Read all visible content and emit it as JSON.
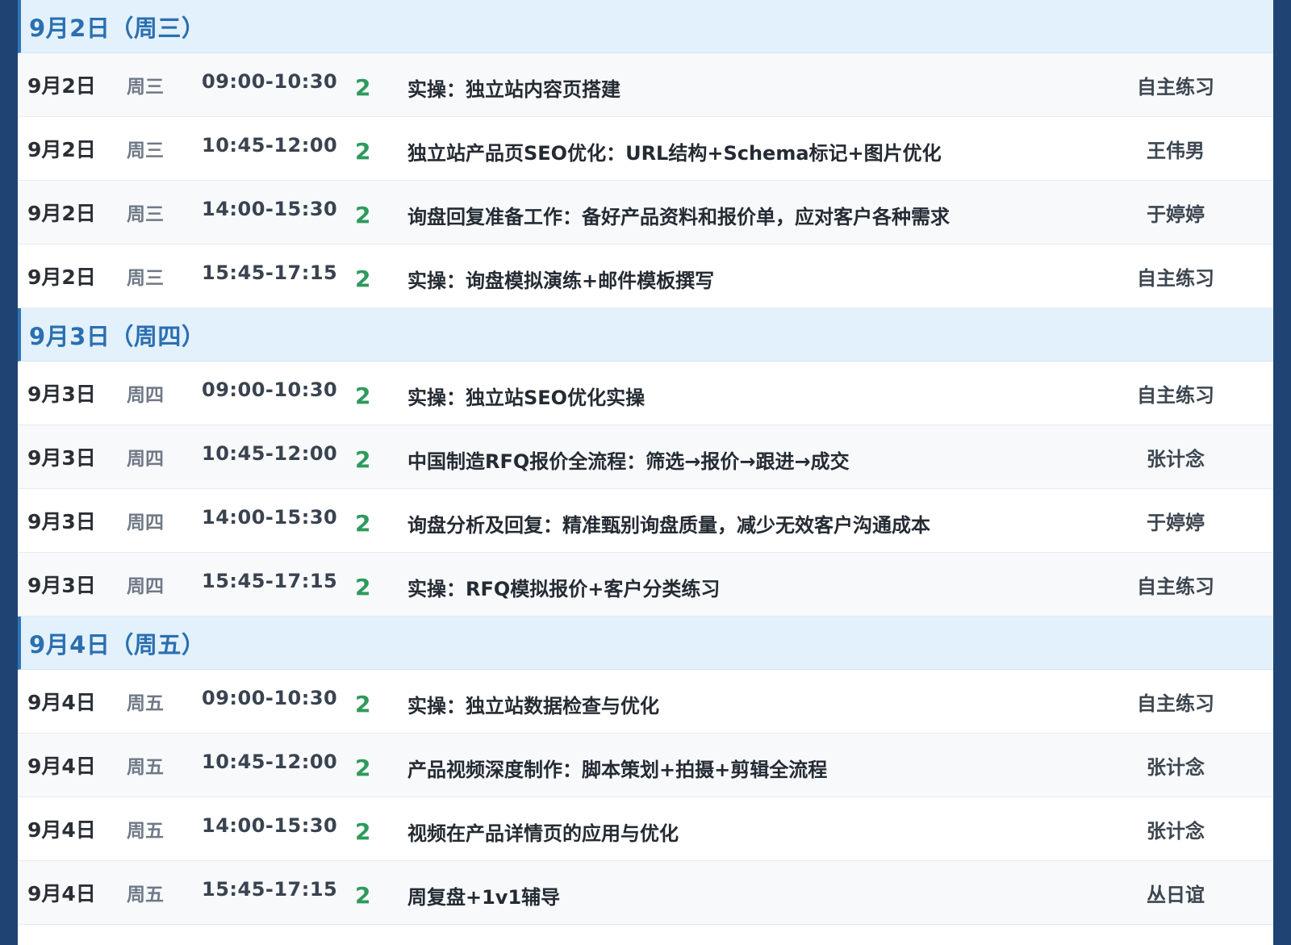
{
  "days": [
    {
      "header": "9月2日（周三）",
      "sessions": [
        {
          "date": "9月2日",
          "weekday": "周三",
          "time": "09:00-10:30",
          "hours": "2",
          "topic": "实操：独立站内容页搭建",
          "teacher": "自主练习"
        },
        {
          "date": "9月2日",
          "weekday": "周三",
          "time": "10:45-12:00",
          "hours": "2",
          "topic": "独立站产品页SEO优化：URL结构+Schema标记+图片优化",
          "teacher": "王伟男"
        },
        {
          "date": "9月2日",
          "weekday": "周三",
          "time": "14:00-15:30",
          "hours": "2",
          "topic": "询盘回复准备工作：备好产品资料和报价单，应对客户各种需求",
          "teacher": "于婷婷"
        },
        {
          "date": "9月2日",
          "weekday": "周三",
          "time": "15:45-17:15",
          "hours": "2",
          "topic": "实操：询盘模拟演练+邮件模板撰写",
          "teacher": "自主练习"
        }
      ]
    },
    {
      "header": "9月3日（周四）",
      "sessions": [
        {
          "date": "9月3日",
          "weekday": "周四",
          "time": "09:00-10:30",
          "hours": "2",
          "topic": "实操：独立站SEO优化实操",
          "teacher": "自主练习"
        },
        {
          "date": "9月3日",
          "weekday": "周四",
          "time": "10:45-12:00",
          "hours": "2",
          "topic": "中国制造RFQ报价全流程：筛选→报价→跟进→成交",
          "teacher": "张计念"
        },
        {
          "date": "9月3日",
          "weekday": "周四",
          "time": "14:00-15:30",
          "hours": "2",
          "topic": "询盘分析及回复：精准甄别询盘质量，减少无效客户沟通成本",
          "teacher": "于婷婷"
        },
        {
          "date": "9月3日",
          "weekday": "周四",
          "time": "15:45-17:15",
          "hours": "2",
          "topic": "实操：RFQ模拟报价+客户分类练习",
          "teacher": "自主练习"
        }
      ]
    },
    {
      "header": "9月4日（周五）",
      "sessions": [
        {
          "date": "9月4日",
          "weekday": "周五",
          "time": "09:00-10:30",
          "hours": "2",
          "topic": "实操：独立站数据检查与优化",
          "teacher": "自主练习"
        },
        {
          "date": "9月4日",
          "weekday": "周五",
          "time": "10:45-12:00",
          "hours": "2",
          "topic": "产品视频深度制作：脚本策划+拍摄+剪辑全流程",
          "teacher": "张计念"
        },
        {
          "date": "9月4日",
          "weekday": "周五",
          "time": "14:00-15:30",
          "hours": "2",
          "topic": "视频在产品详情页的应用与优化",
          "teacher": "张计念"
        },
        {
          "date": "9月4日",
          "weekday": "周五",
          "time": "15:45-17:15",
          "hours": "2",
          "topic": "周复盘+1v1辅导",
          "teacher": "丛日谊"
        }
      ]
    }
  ]
}
